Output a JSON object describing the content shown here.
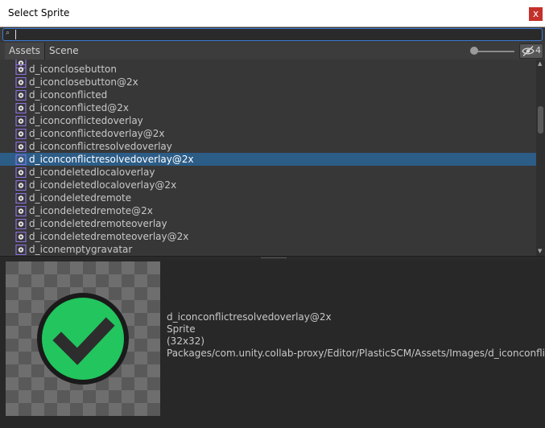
{
  "window": {
    "title": "Select Sprite",
    "close_glyph": "x"
  },
  "search": {
    "value": "",
    "icon": "search-icon"
  },
  "tabs": [
    {
      "label": "Assets",
      "active": true
    },
    {
      "label": "Scene",
      "active": false
    }
  ],
  "toolbar": {
    "hidden_count": "4",
    "visibility_icon": "eye-slash-icon"
  },
  "list": {
    "items": [
      {
        "label": "d_iconclosebutton",
        "selected": false
      },
      {
        "label": "d_iconclosebutton@2x",
        "selected": false
      },
      {
        "label": "d_iconconflicted",
        "selected": false
      },
      {
        "label": "d_iconconflicted@2x",
        "selected": false
      },
      {
        "label": "d_iconconflictedoverlay",
        "selected": false
      },
      {
        "label": "d_iconconflictedoverlay@2x",
        "selected": false
      },
      {
        "label": "d_iconconflictresolvedoverlay",
        "selected": false
      },
      {
        "label": "d_iconconflictresolvedoverlay@2x",
        "selected": true
      },
      {
        "label": "d_icondeletedlocaloverlay",
        "selected": false
      },
      {
        "label": "d_icondeletedlocaloverlay@2x",
        "selected": false
      },
      {
        "label": "d_icondeletedremote",
        "selected": false
      },
      {
        "label": "d_icondeletedremote@2x",
        "selected": false
      },
      {
        "label": "d_icondeletedremoteoverlay",
        "selected": false
      },
      {
        "label": "d_icondeletedremoteoverlay@2x",
        "selected": false
      },
      {
        "label": "d_iconemptygravatar",
        "selected": false
      }
    ]
  },
  "preview": {
    "name": "d_iconconflictresolvedoverlay@2x",
    "type": "Sprite",
    "size": "(32x32)",
    "path": "Packages/com.unity.collab-proxy/Editor/PlasticSCM/Assets/Images/d_iconconflict",
    "icon": "checkmark-circle-icon"
  },
  "colors": {
    "selection": "#2c5d87",
    "check_green": "#22c55e",
    "close_red": "#c4302b"
  }
}
